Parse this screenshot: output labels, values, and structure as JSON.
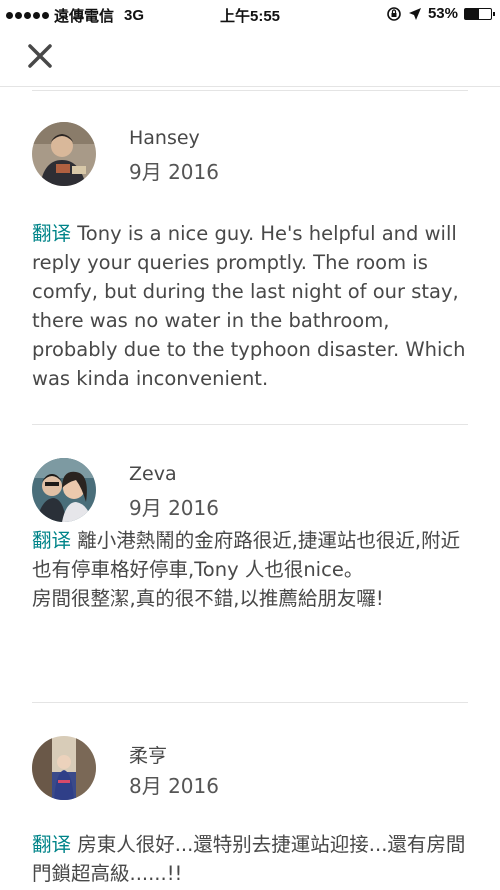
{
  "status_bar": {
    "carrier": "遠傳電信",
    "network": "3G",
    "time": "上午5:55",
    "battery_percent": "53%",
    "battery_level": 0.53
  },
  "nav": {
    "close_icon": "close-icon"
  },
  "reviews": [
    {
      "name": "Hansey",
      "date": "9月 2016",
      "translate_label": "翻译",
      "text": " Tony is a nice guy. He's helpful and will reply your queries promptly. The room is comfy, but during the last night of our stay, there was no water in the bathroom, probably due to the typhoon disaster. Which was kinda inconvenient."
    },
    {
      "name": "Zeva",
      "date": "9月 2016",
      "translate_label": "翻译",
      "text": " 離小港熱鬧的金府路很近,捷運站也很近,附近也有停車格好停車,Tony 人也很nice。\n房間很整潔,真的很不錯,以推薦給朋友囉!"
    },
    {
      "name": "柔亨",
      "date": "8月 2016",
      "translate_label": "翻译",
      "text": " 房東人很好...還特别去捷運站迎接...還有房間門鎖超高級......!!"
    }
  ],
  "colors": {
    "accent": "#008489",
    "text": "#484848",
    "divider": "#e4e4e4"
  }
}
